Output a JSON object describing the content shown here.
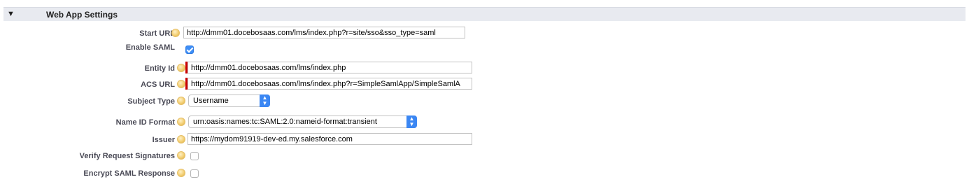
{
  "section": {
    "toggle_icon": "triangle-down-icon",
    "title": "Web App Settings"
  },
  "fields": {
    "start_url": {
      "label": "Start URL",
      "value": "http://dmm01.docebosaas.com/lms/index.php?r=site/sso&sso_type=saml"
    },
    "enable_saml": {
      "label": "Enable SAML",
      "checked": true
    },
    "entity_id": {
      "label": "Entity Id",
      "value": "http://dmm01.docebosaas.com/lms/index.php"
    },
    "acs_url": {
      "label": "ACS URL",
      "value": "http://dmm01.docebosaas.com/lms/index.php?r=SimpleSamlApp/SimpleSamlA"
    },
    "subject_type": {
      "label": "Subject Type",
      "value": "Username"
    },
    "name_id_format": {
      "label": "Name ID Format",
      "value": "urn:oasis:names:tc:SAML:2.0:nameid-format:transient"
    },
    "issuer": {
      "label": "Issuer",
      "value": "https://mydom91919-dev-ed.my.salesforce.com"
    },
    "verify_request_signatures": {
      "label": "Verify Request Signatures",
      "checked": false
    },
    "encrypt_saml_response": {
      "label": "Encrypt SAML Response",
      "checked": false
    }
  },
  "colors": {
    "header_bg": "#e8eaf0",
    "required": "#cc0000",
    "checkbox_checked": "#3d8ef7",
    "select_stepper": "#3b87f3"
  }
}
